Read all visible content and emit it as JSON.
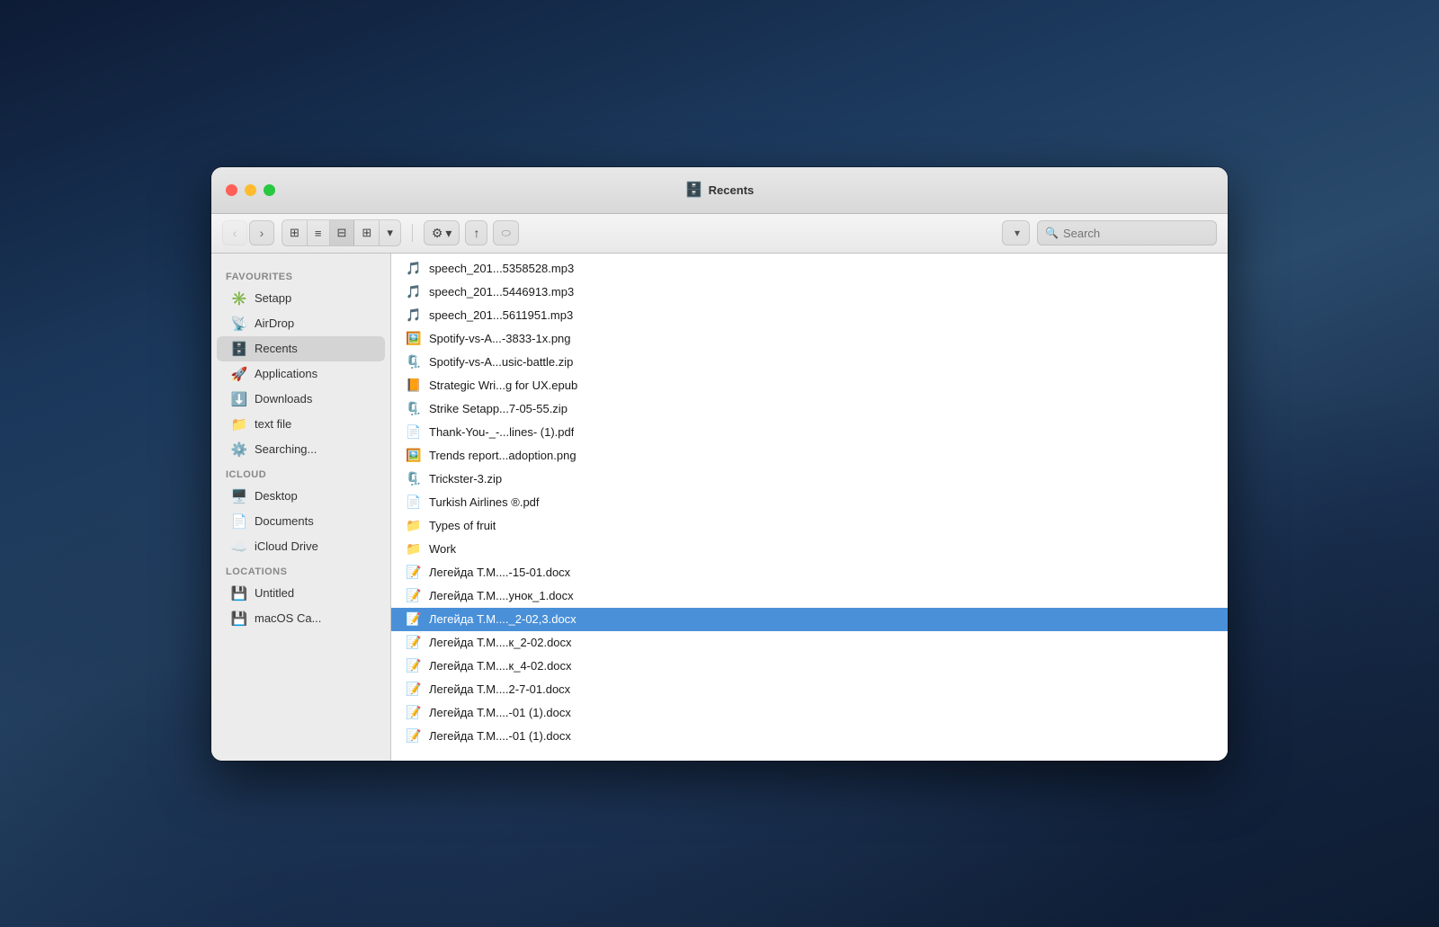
{
  "window": {
    "title": "Recents",
    "title_icon": "🗄️"
  },
  "toolbar": {
    "back_label": "‹",
    "forward_label": "›",
    "view_icons_label": "⊞",
    "view_list_label": "≡",
    "view_columns_label": "⊟",
    "view_gallery_label": "⊞",
    "actions_label": "⚙",
    "share_label": "↑",
    "tag_label": "⬭",
    "search_placeholder": "Search"
  },
  "sidebar": {
    "favourites_header": "Favourites",
    "items_favourites": [
      {
        "id": "setapp",
        "label": "Setapp",
        "icon": "✳️"
      },
      {
        "id": "airdrop",
        "label": "AirDrop",
        "icon": "📡"
      },
      {
        "id": "recents",
        "label": "Recents",
        "icon": "🗄️",
        "active": true
      },
      {
        "id": "applications",
        "label": "Applications",
        "icon": "🚀"
      },
      {
        "id": "downloads",
        "label": "Downloads",
        "icon": "⬇️"
      },
      {
        "id": "text-file",
        "label": "text file",
        "icon": "📁"
      },
      {
        "id": "searching",
        "label": "Searching...",
        "icon": "⚙️"
      }
    ],
    "icloud_header": "iCloud",
    "items_icloud": [
      {
        "id": "desktop",
        "label": "Desktop",
        "icon": "🖥️"
      },
      {
        "id": "documents",
        "label": "Documents",
        "icon": "📄"
      },
      {
        "id": "icloud-drive",
        "label": "iCloud Drive",
        "icon": "☁️"
      }
    ],
    "locations_header": "Locations",
    "items_locations": [
      {
        "id": "untitled",
        "label": "Untitled",
        "icon": "💾"
      },
      {
        "id": "macos",
        "label": "macOS Ca...",
        "icon": "💾"
      }
    ]
  },
  "files": [
    {
      "id": 1,
      "name": "speech_201...5358528.mp3",
      "icon": "🎵",
      "selected": false
    },
    {
      "id": 2,
      "name": "speech_201...5446913.mp3",
      "icon": "🎵",
      "selected": false
    },
    {
      "id": 3,
      "name": "speech_201...5611951.mp3",
      "icon": "🎵",
      "selected": false
    },
    {
      "id": 4,
      "name": "Spotify-vs-A...-3833-1x.png",
      "icon": "🖼️",
      "selected": false
    },
    {
      "id": 5,
      "name": "Spotify-vs-A...usic-battle.zip",
      "icon": "🗜️",
      "selected": false
    },
    {
      "id": 6,
      "name": "Strategic Wri...g for UX.epub",
      "icon": "📙",
      "selected": false
    },
    {
      "id": 7,
      "name": "Strike Setapp...7-05-55.zip",
      "icon": "🗜️",
      "selected": false
    },
    {
      "id": 8,
      "name": "Thank-You-_-...lines- (1).pdf",
      "icon": "📄",
      "selected": false
    },
    {
      "id": 9,
      "name": "Trends report...adoption.png",
      "icon": "🖼️",
      "selected": false
    },
    {
      "id": 10,
      "name": "Trickster-3.zip",
      "icon": "🗜️",
      "selected": false
    },
    {
      "id": 11,
      "name": "Turkish Airlines ®.pdf",
      "icon": "📄",
      "selected": false
    },
    {
      "id": 12,
      "name": "Types of fruit",
      "icon": "📁",
      "selected": false
    },
    {
      "id": 13,
      "name": "Work",
      "icon": "📁",
      "selected": false
    },
    {
      "id": 14,
      "name": "Легейда Т.М....-15-01.docx",
      "icon": "📝",
      "selected": false
    },
    {
      "id": 15,
      "name": "Легейда Т.М....унок_1.docx",
      "icon": "📝",
      "selected": false
    },
    {
      "id": 16,
      "name": "Легейда Т.М...._2-02,3.docx",
      "icon": "📝",
      "selected": true
    },
    {
      "id": 17,
      "name": "Легейда Т.М....к_2-02.docx",
      "icon": "📝",
      "selected": false
    },
    {
      "id": 18,
      "name": "Легейда Т.М....к_4-02.docx",
      "icon": "📝",
      "selected": false
    },
    {
      "id": 19,
      "name": "Легейда Т.М....2-7-01.docx",
      "icon": "📝",
      "selected": false
    },
    {
      "id": 20,
      "name": "Легейда Т.М....-01 (1).docx",
      "icon": "📝",
      "selected": false
    },
    {
      "id": 21,
      "name": "Легейда Т.М....-01 (1).docx",
      "icon": "📝",
      "selected": false
    }
  ]
}
